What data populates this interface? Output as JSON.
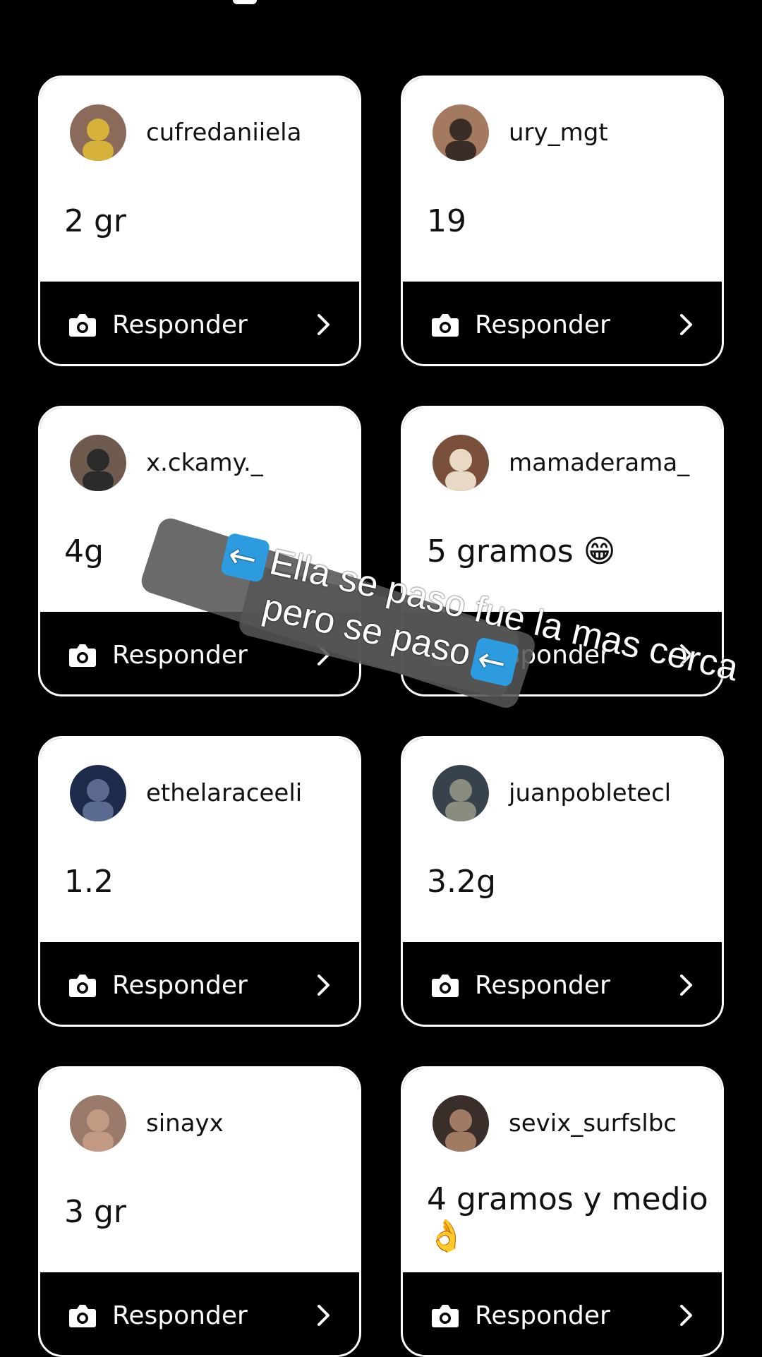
{
  "cards": [
    {
      "username": "cufredaniiela",
      "answer": "2 gr",
      "reply_label": "Responder",
      "avatar": {
        "bg": "#8a6a5a",
        "fg": "#d6b23a"
      }
    },
    {
      "username": "ury_mgt",
      "answer": "19",
      "reply_label": "Responder",
      "avatar": {
        "bg": "#a3795f",
        "fg": "#3a2d28"
      }
    },
    {
      "username": "x.ckamy._",
      "answer": "4g",
      "reply_label": "Responder",
      "avatar": {
        "bg": "#6f5a4e",
        "fg": "#2b2b2b"
      }
    },
    {
      "username": "mamaderama_",
      "answer": "5 gramos 😁",
      "reply_label": "Responder",
      "avatar": {
        "bg": "#7a4f3c",
        "fg": "#e7d9c4"
      }
    },
    {
      "username": "ethelaraceeli",
      "answer": "1.2",
      "reply_label": "Responder",
      "avatar": {
        "bg": "#1d2a4a",
        "fg": "#5a6a90"
      }
    },
    {
      "username": "juanpobletecl",
      "answer": "3.2g",
      "reply_label": "Responder",
      "avatar": {
        "bg": "#37424c",
        "fg": "#8a8c80"
      }
    },
    {
      "username": "sinayx",
      "answer": "3 gr",
      "reply_label": "Responder",
      "avatar": {
        "bg": "#9a7a6a",
        "fg": "#c29a84"
      }
    },
    {
      "username": "sevix_surfslbc",
      "answer": "4 gramos y medio 👌",
      "reply_label": "Responder",
      "avatar": {
        "bg": "#3a2e2a",
        "fg": "#a07a62"
      }
    }
  ],
  "overlay": {
    "line1": "Ella se paso fue la mas cerca",
    "line2": "pero se paso"
  }
}
